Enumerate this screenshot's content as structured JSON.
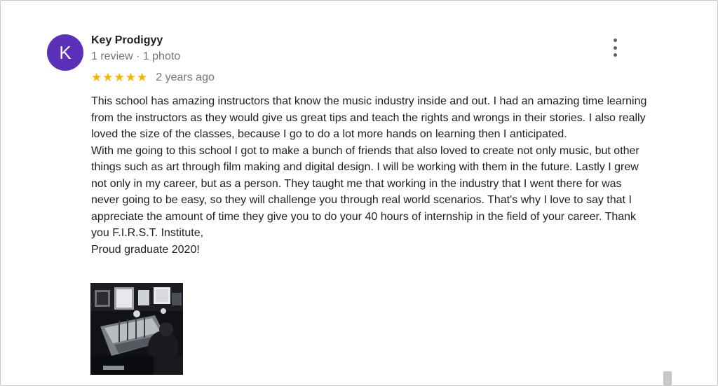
{
  "review": {
    "author": {
      "initial": "K",
      "name": "Key Prodigyy",
      "meta": "1 review · 1 photo"
    },
    "rating": 5,
    "rating_stars": [
      "★",
      "★",
      "★",
      "★",
      "★"
    ],
    "age": "2 years ago",
    "paragraphs": [
      "This school has amazing instructors that know the music industry inside and out. I had an amazing time learning from the instructors as they would give us great tips and teach the rights and wrongs in their stories. I also really loved the size of the classes, because I go to do a lot more hands on learning then I anticipated.",
      "With me going to this school I got to make a bunch of friends that also loved to create not only music, but other things such as art through film making and digital design. I will be working with them in the future. Lastly I grew not only in my career, but as a person. They taught me that working in the industry that I went there for was never going to be easy, so they will challenge you through real world scenarios. That's why I love to say that I appreciate the amount of time they give you to do your 40 hours of internship in the field of your career. Thank you F.I.R.S.T. Institute,",
      "Proud graduate 2020!"
    ],
    "photo_label": "PHOTO"
  },
  "colors": {
    "avatar_bg": "#5b30b8",
    "star": "#f4b400",
    "meta_text": "#70757a",
    "body_text": "#202124"
  },
  "icons": {
    "more_options": "more-vert-icon",
    "star": "star-icon"
  }
}
